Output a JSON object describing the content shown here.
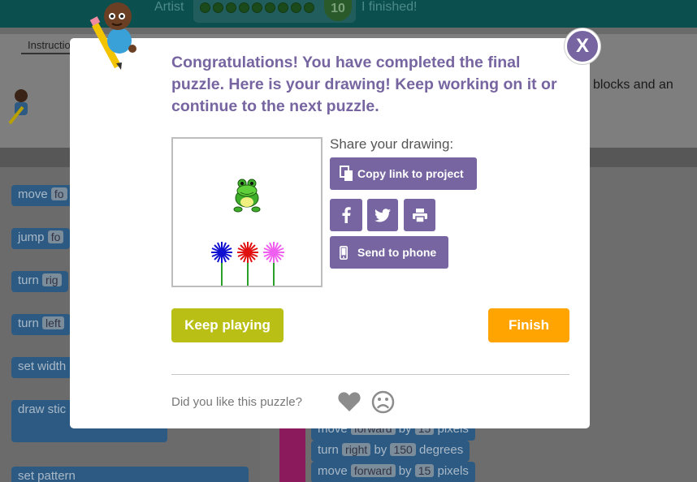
{
  "header": {
    "artist_label": "Artist",
    "level_number": "10",
    "finished_label": "I finished!"
  },
  "instructions": {
    "tab_label": "Instructions",
    "text_fragment": "blocks and an"
  },
  "toolbox": {
    "blocks": [
      {
        "kw": "move",
        "slot": "fo"
      },
      {
        "kw": "jump",
        "slot": "fo"
      },
      {
        "kw": "turn",
        "slot": "rig"
      },
      {
        "kw": "turn",
        "slot": "left"
      },
      {
        "kw": "set width",
        "slot": ""
      },
      {
        "kw": "draw stic",
        "slot": ""
      },
      {
        "kw": "set pattern",
        "slot": ""
      }
    ]
  },
  "workspace": {
    "blocks": [
      {
        "kw": "move",
        "dir": "forward",
        "by": "by",
        "val": "15",
        "unit": "pixels"
      },
      {
        "kw": "turn",
        "dir": "right",
        "by": "by",
        "val": "150",
        "unit": "degrees"
      },
      {
        "kw": "move",
        "dir": "forward",
        "by": "by",
        "val": "15",
        "unit": "pixels"
      }
    ]
  },
  "dialog": {
    "message": "Congratulations! You have completed the final puzzle. Here is your drawing! Keep working on it or continue to the next puzzle.",
    "close_label": "X",
    "share_label": "Share your drawing:",
    "copy_link_label": "Copy link to project",
    "send_to_phone_label": "Send to phone",
    "keep_playing_label": "Keep playing",
    "finish_label": "Finish",
    "feedback_question": "Did you like this puzzle?"
  },
  "colors": {
    "purple": "#7665a0",
    "lime": "#b9bf15",
    "orange": "#ffa400",
    "teal": "#0b4f4f"
  },
  "icons": [
    "copy-icon",
    "facebook-icon",
    "twitter-icon",
    "print-icon",
    "phone-icon",
    "heart-icon",
    "frown-icon",
    "close-icon"
  ]
}
